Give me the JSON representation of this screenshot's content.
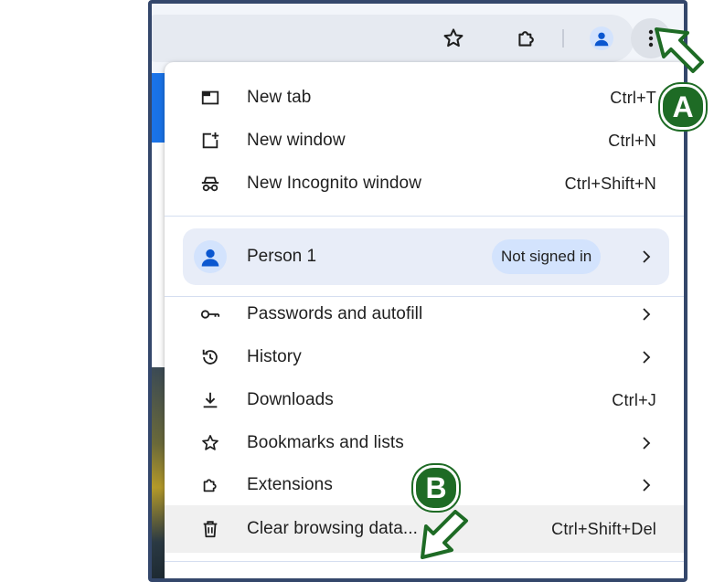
{
  "toolbar": {
    "icons": {
      "bookmark": "star-outline-icon",
      "extensions": "puzzle-piece-icon",
      "profile": "person-avatar-icon",
      "menu": "vertical-dots-icon"
    }
  },
  "menu": {
    "top_items": [
      {
        "label": "New tab",
        "shortcut": "Ctrl+T",
        "icon": "new-tab-icon"
      },
      {
        "label": "New window",
        "shortcut": "Ctrl+N",
        "icon": "new-window-icon"
      },
      {
        "label": "New Incognito window",
        "shortcut": "Ctrl+Shift+N",
        "icon": "incognito-icon"
      }
    ],
    "profile": {
      "name": "Person 1",
      "status": "Not signed in",
      "icon": "person-avatar-icon"
    },
    "items": [
      {
        "label": "Passwords and autofill",
        "shortcut": "",
        "submenu": true,
        "icon": "key-icon"
      },
      {
        "label": "History",
        "shortcut": "",
        "submenu": true,
        "icon": "history-icon"
      },
      {
        "label": "Downloads",
        "shortcut": "Ctrl+J",
        "submenu": false,
        "icon": "download-icon"
      },
      {
        "label": "Bookmarks and lists",
        "shortcut": "",
        "submenu": true,
        "icon": "star-outline-icon"
      },
      {
        "label": "Extensions",
        "shortcut": "",
        "submenu": true,
        "icon": "puzzle-piece-icon"
      },
      {
        "label": "Clear browsing data...",
        "shortcut": "Ctrl+Shift+Del",
        "submenu": false,
        "icon": "trash-icon",
        "highlighted": true
      }
    ]
  },
  "callouts": {
    "a": {
      "label": "A"
    },
    "b": {
      "label": "B"
    }
  },
  "colors": {
    "frame_border": "#34476b",
    "callout_green": "#1e6b25",
    "accent_blue": "#0b57d0",
    "profile_badge": "#d3e3fd",
    "profile_row": "#e8edf8"
  }
}
